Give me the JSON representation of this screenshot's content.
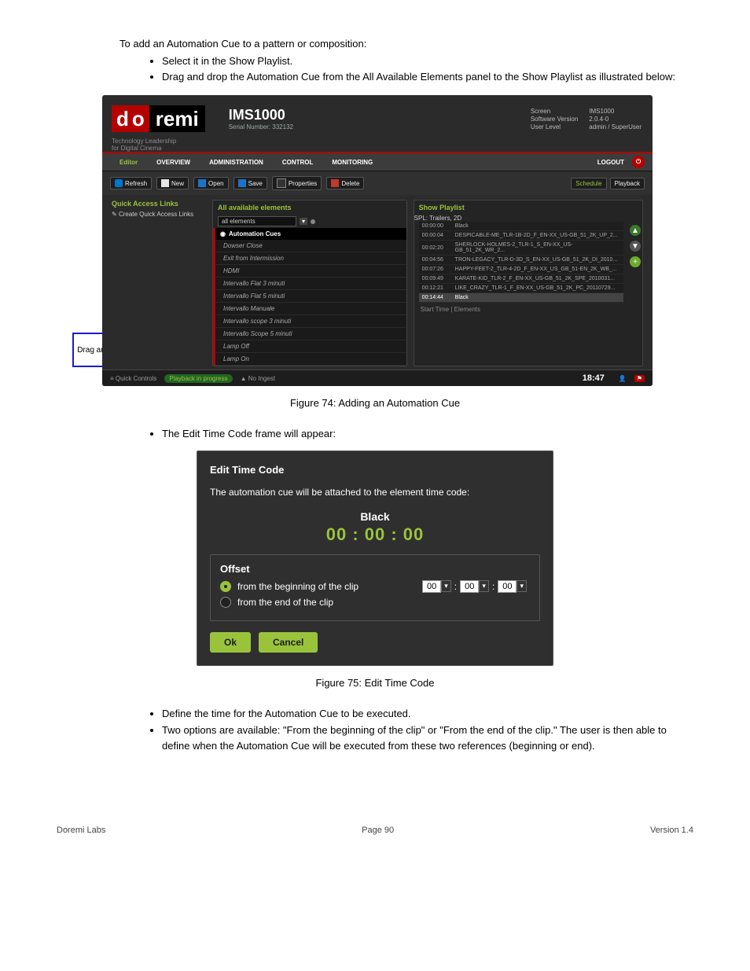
{
  "doc": {
    "intro": "To add an Automation Cue to a pattern or composition:",
    "bullets_a": [
      "Select it in the Show Playlist.",
      "Drag and drop the Automation Cue from the All Available Elements panel to the Show Playlist as illustrated below:"
    ],
    "callout": "Drag and Drop",
    "caption_a": "Figure 74: Adding an Automation Cue",
    "bullets_b": [
      "The Edit Time Code frame will appear:"
    ],
    "caption_b": "Figure 75: Edit Time Code",
    "bullets_c": [
      "Define the time for the Automation Cue to be executed.",
      "Two options are available: \"From the beginning of the clip\" or \"From the end of the clip.\" The user is then able to define when the Automation Cue will be executed from these two references (beginning or end)."
    ]
  },
  "ims": {
    "logo_d": "d",
    "logo_o": "o",
    "logo_rest": "remi",
    "title": "IMS1000",
    "serial": "Serial Number: 332132",
    "tagline1": "Technology Leadership",
    "tagline2": "for Digital Cinema",
    "info": {
      "screen_k": "Screen",
      "screen_v": "IMS1000",
      "sw_k": "Software Version",
      "sw_v": "2.0.4-0",
      "lvl_k": "User Level",
      "lvl_v": "admin / SuperUser"
    },
    "nav": {
      "editor": "Editor",
      "overview": "OVERVIEW",
      "admin": "ADMINISTRATION",
      "control": "CONTROL",
      "monitor": "MONITORING",
      "logout": "LOGOUT"
    },
    "toolbar": {
      "refresh": "Refresh",
      "new": "New",
      "open": "Open",
      "save": "Save",
      "props": "Properties",
      "delete": "Delete",
      "schedule": "Schedule",
      "playback": "Playback"
    },
    "side": {
      "qal": "Quick Access Links",
      "create": "Create Quick Access Links"
    },
    "left": {
      "title": "All available elements",
      "filter": "all elements",
      "cat": "Automation Cues",
      "items": [
        "Dowser Close",
        "Exit from Intermission",
        "HDMI",
        "Intervallo Flat 3 minuti",
        "Intervallo Flat 5 minuti",
        "Intervallo Manuale",
        "Intervallo scope 3 minuti",
        "Intervallo Scope 5 minuti",
        "Lamp Off",
        "Lamp On"
      ]
    },
    "right": {
      "title": "Show Playlist",
      "spl": "SPL: Trailers, 2D",
      "rows": [
        {
          "t": "00:00:00",
          "n": "Black"
        },
        {
          "t": "00:00:04",
          "n": "DESPICABLE-ME_TLR-1B-2D_F_EN-XX_US-GB_51_2K_UP_2..."
        },
        {
          "t": "00:02:20",
          "n": "SHERLOCK-HOLMES-2_TLR-1_S_EN-XX_US-GB_51_2K_WR_2..."
        },
        {
          "t": "00:04:56",
          "n": "TRON-LEGACY_TLR-D-3D_S_EN-XX_US-GB_51_2K_DI_2010..."
        },
        {
          "t": "00:07:26",
          "n": "HAPPY-FEET-2_TLR-4-2D_F_EN-XX_US_GB_51-EN_2K_WB_..."
        },
        {
          "t": "00:09:49",
          "n": "KARATE-KID_TLR-2_F_EN-XX_US-GB_51_2K_SPE_2010031..."
        },
        {
          "t": "00:12:21",
          "n": "LIKE_CRAZY_TLR-1_F_EN-XX_US-GB_51_2K_PC_20110729..."
        },
        {
          "t": "00:14:44",
          "n": "Black",
          "sel": true
        }
      ],
      "foot": "Start Time | Elements"
    },
    "status": {
      "quick": "Quick Controls",
      "play": "Playback in progress",
      "ingest": "No Ingest",
      "clock": "18:47"
    }
  },
  "dialog": {
    "title": "Edit Time Code",
    "msg": "The automation cue will be attached to the element time code:",
    "element": "Black",
    "tc": "00 : 00 : 00",
    "offset": "Offset",
    "opt_begin": "from the beginning of the clip",
    "opt_end": "from the end of the clip",
    "hh": "00",
    "mm": "00",
    "ss": "00",
    "colon": ":",
    "ok": "Ok",
    "cancel": "Cancel"
  },
  "footer": {
    "left": "Doremi Labs",
    "center": "Page 90",
    "right": "Version 1.4"
  }
}
